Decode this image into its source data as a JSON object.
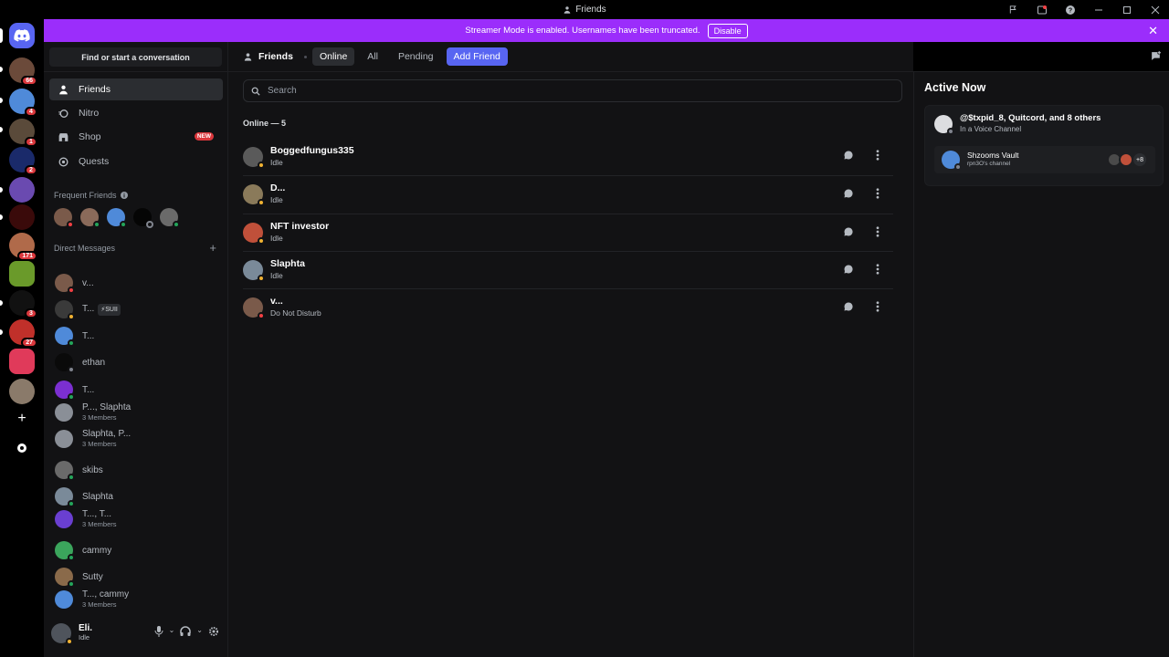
{
  "window": {
    "title": "Friends"
  },
  "banner": {
    "text": "Streamer Mode is enabled. Usernames have been truncated.",
    "disable_label": "Disable"
  },
  "server_badges": [
    "66",
    "4",
    "1",
    "2",
    "171",
    "3",
    "27"
  ],
  "sidebar": {
    "find_label": "Find or start a conversation",
    "nav": [
      {
        "label": "Friends",
        "icon": "friends-icon"
      },
      {
        "label": "Nitro",
        "icon": "nitro-icon"
      },
      {
        "label": "Shop",
        "icon": "shop-icon",
        "badge": "NEW"
      },
      {
        "label": "Quests",
        "icon": "quests-icon"
      }
    ],
    "frequent_label": "Frequent Friends",
    "dm_label": "Direct Messages",
    "dms": [
      {
        "name": "v...",
        "sub": "",
        "status": "dnd",
        "color": "#7a5a4a"
      },
      {
        "name": "T...",
        "sub": "",
        "tag": "⚡SUII",
        "status": "idle",
        "color": "#3a3a3a"
      },
      {
        "name": "T...",
        "sub": "",
        "status": "online",
        "color": "#4f8ad9"
      },
      {
        "name": "ethan",
        "sub": "",
        "status": "offline",
        "color": "#0a0a0a"
      },
      {
        "name": "T...",
        "sub": "",
        "status": "online",
        "color": "#7b2fd1"
      },
      {
        "name": "P..., Slaphta",
        "sub": "3 Members",
        "status": "",
        "color": "#8a8f97"
      },
      {
        "name": "Slaphta, P...",
        "sub": "3 Members",
        "status": "",
        "color": "#8a8f97"
      },
      {
        "name": "skibs",
        "sub": "",
        "status": "online",
        "color": "#6a6a6a"
      },
      {
        "name": "Slaphta",
        "sub": "",
        "status": "online",
        "color": "#7a8a99"
      },
      {
        "name": "T..., T...",
        "sub": "3 Members",
        "status": "",
        "color": "#6a3fd1"
      },
      {
        "name": "cammy",
        "sub": "",
        "status": "online",
        "color": "#3ba55c"
      },
      {
        "name": "Sutty",
        "sub": "",
        "status": "online",
        "color": "#8a6a4a"
      },
      {
        "name": "T..., cammy",
        "sub": "3 Members",
        "status": "",
        "color": "#4f8ad9"
      }
    ],
    "user": {
      "name": "Eli.",
      "status": "Idle"
    }
  },
  "topbar": {
    "friends_label": "Friends",
    "tabs": [
      "Online",
      "All",
      "Pending"
    ],
    "add_friend": "Add Friend"
  },
  "search": {
    "placeholder": "Search"
  },
  "online_label": "Online — 5",
  "friends": [
    {
      "name": "Boggedfungus335",
      "status": "Idle",
      "dot": "idle",
      "color": "#5a5a5a"
    },
    {
      "name": "D...",
      "status": "Idle",
      "dot": "idle",
      "color": "#8a7a5a"
    },
    {
      "name": "NFT investor",
      "status": "Idle",
      "dot": "idle",
      "color": "#c0503a"
    },
    {
      "name": "Slaphta",
      "status": "Idle",
      "dot": "idle",
      "color": "#7a8a99"
    },
    {
      "name": "v...",
      "status": "Do Not Disturb",
      "dot": "dnd",
      "color": "#7a5a4a"
    }
  ],
  "active_now": {
    "title": "Active Now",
    "main": "@$txpid_8, Quitcord, and 8 others",
    "sub": "In a Voice Channel",
    "vc_name": "Shzooms Vault",
    "vc_sub": "rpn3O's channel",
    "more": "+8"
  },
  "colors": {
    "accent": "#5865f2",
    "banner": "#9b2dfb",
    "idle": "#f0b232",
    "dnd": "#f23f43",
    "online": "#23a55a",
    "offline": "#80848e"
  }
}
